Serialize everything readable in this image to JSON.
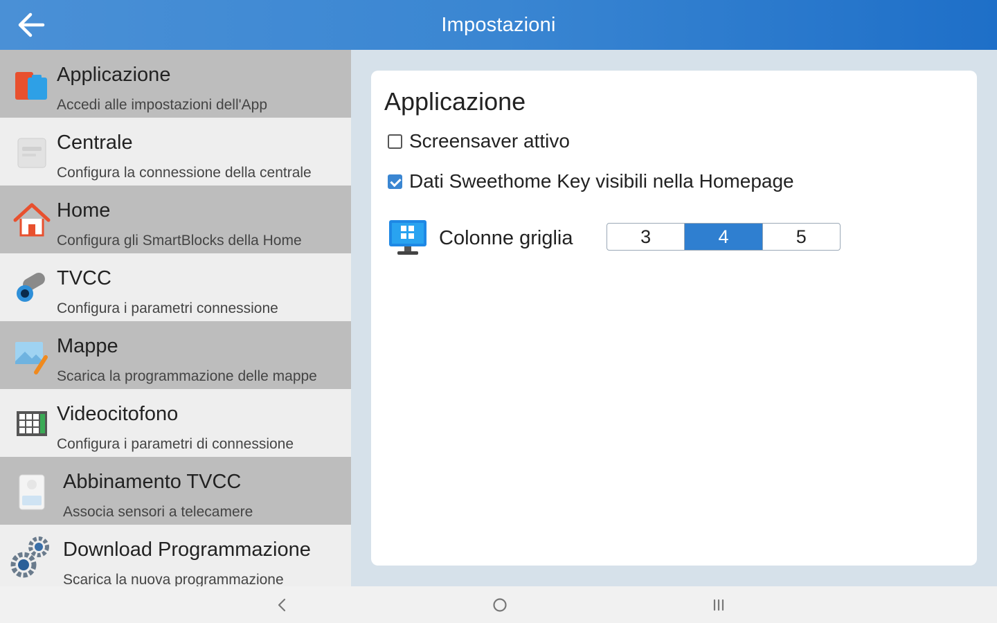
{
  "header": {
    "title": "Impostazioni",
    "back_icon": "arrow-left-icon"
  },
  "sidebar": {
    "items": [
      {
        "title": "Applicazione",
        "subtitle": "Accedi alle impostazioni dell'App",
        "icon": "app-icon",
        "selected": true
      },
      {
        "title": "Centrale",
        "subtitle": "Configura la connessione della centrale",
        "icon": "control-unit-icon"
      },
      {
        "title": "Home",
        "subtitle": "Configura gli SmartBlocks della Home",
        "icon": "home-icon"
      },
      {
        "title": "TVCC",
        "subtitle": "Configura i parametri connessione",
        "icon": "cctv-camera-icon"
      },
      {
        "title": "Mappe",
        "subtitle": "Scarica la programmazione delle mappe",
        "icon": "map-picture-icon"
      },
      {
        "title": "Videocitofono",
        "subtitle": "Configura i parametri di connessione",
        "icon": "video-intercom-icon"
      },
      {
        "title": "Abbinamento TVCC",
        "subtitle": "Associa sensori a telecamere",
        "icon": "sensor-pairing-icon"
      },
      {
        "title": "Download Programmazione",
        "subtitle": "Scarica la nuova programmazione",
        "icon": "gears-icon"
      }
    ]
  },
  "main": {
    "title": "Applicazione",
    "screensaver": {
      "label": "Screensaver attivo",
      "checked": false
    },
    "sweethome": {
      "label": "Dati Sweethome Key visibili nella Homepage",
      "checked": true
    },
    "grid": {
      "label": "Colonne griglia",
      "icon": "monitor-grid-icon",
      "options": [
        "3",
        "4",
        "5"
      ],
      "selected": "4"
    }
  },
  "navbar": {
    "back": "nav-back-icon",
    "home": "nav-home-icon",
    "recents": "nav-recents-icon"
  },
  "colors": {
    "accent": "#2f7fd0",
    "sidebar_selected": "#bdbdbd",
    "content_bg": "#d6e1ea"
  }
}
